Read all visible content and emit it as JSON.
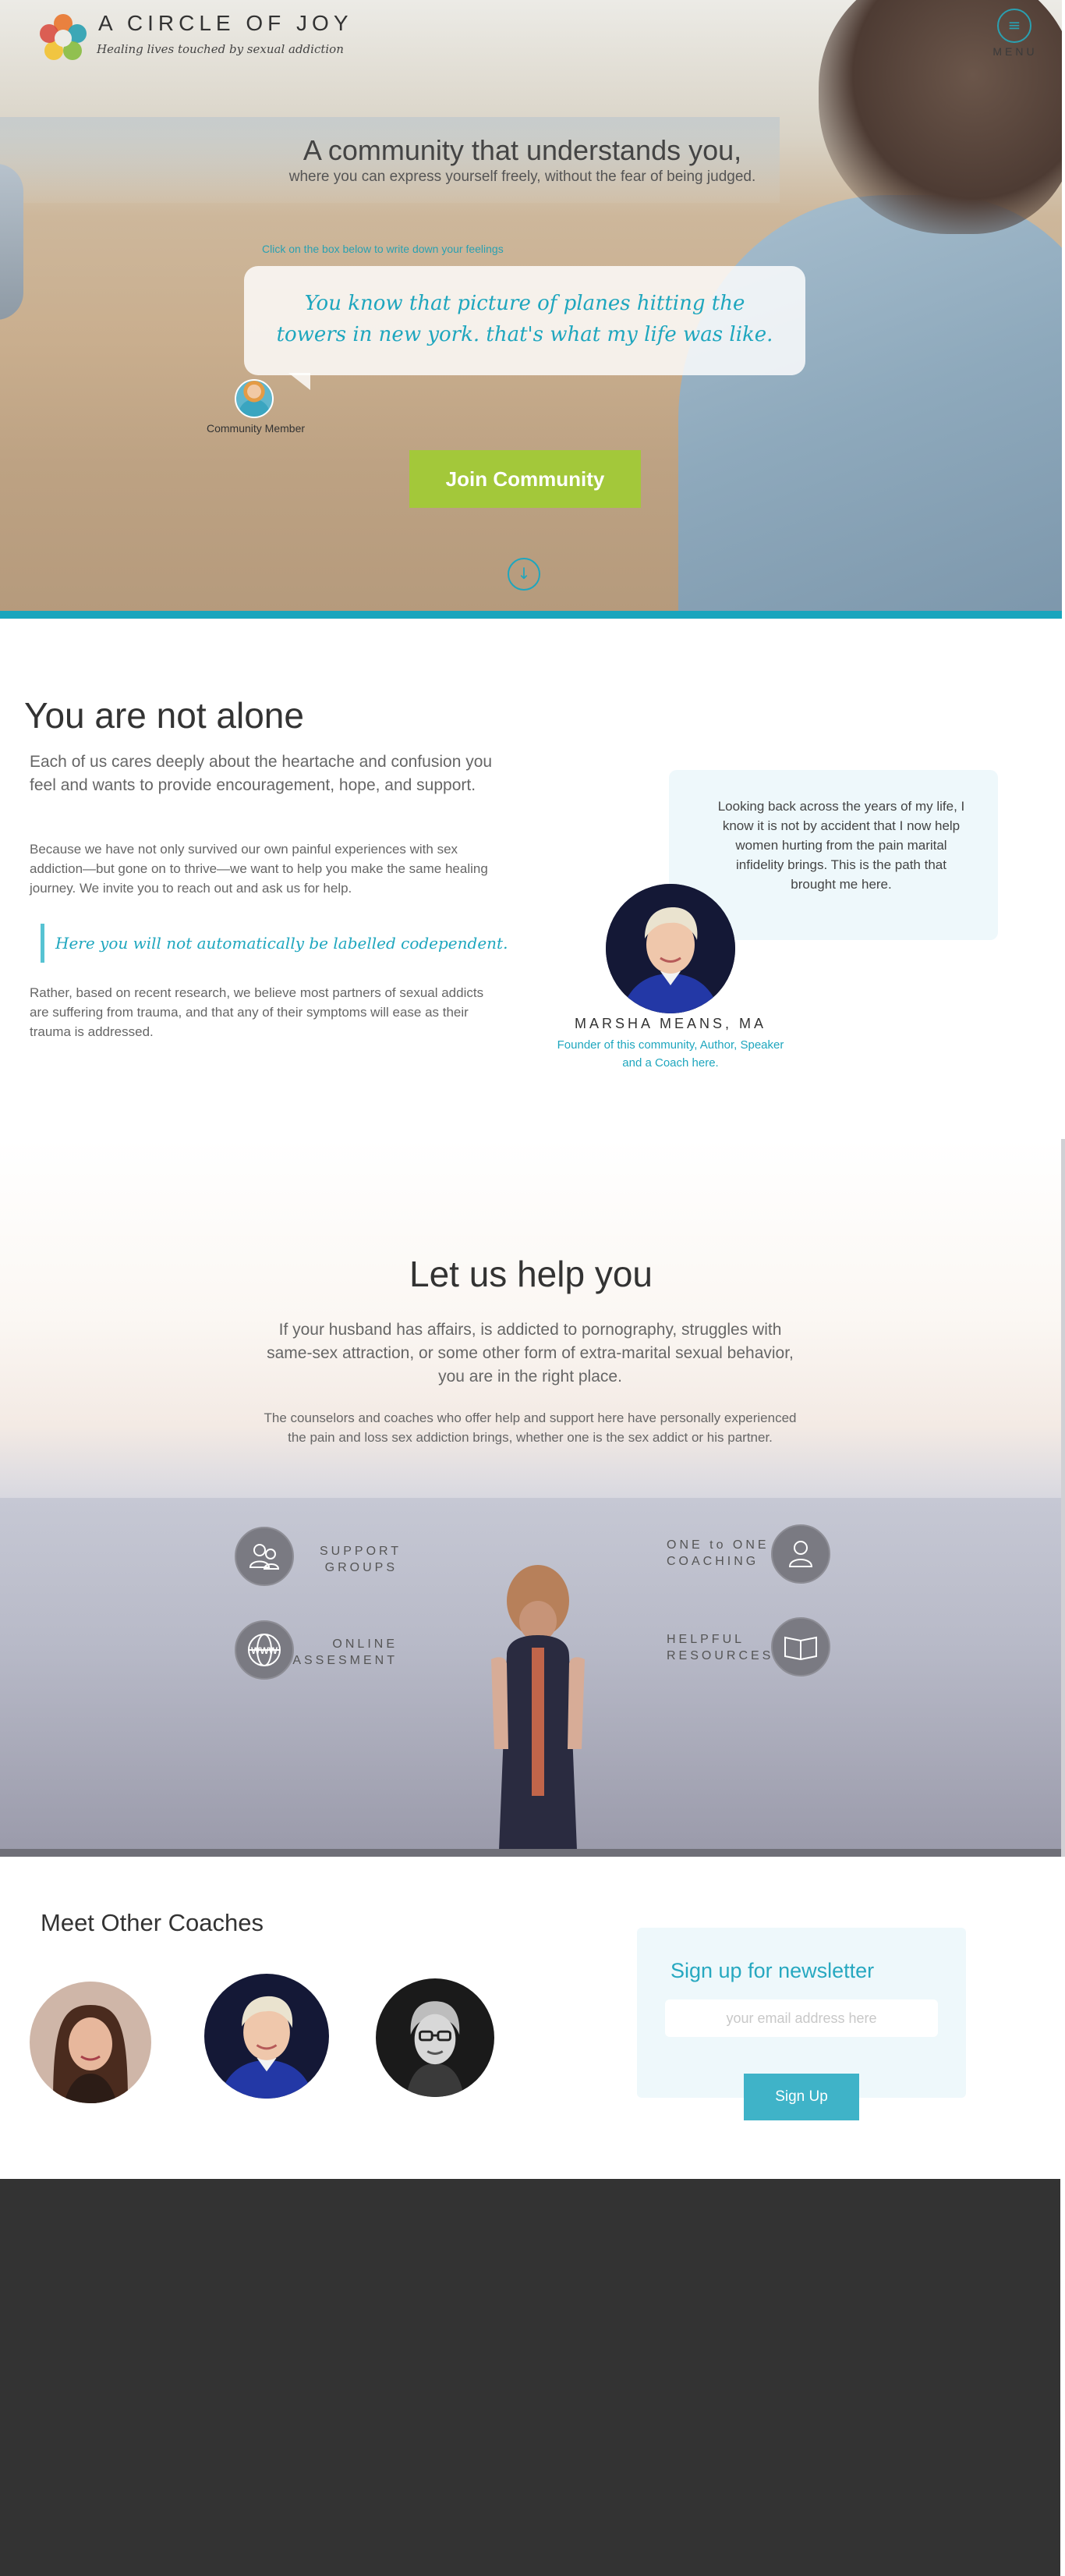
{
  "header": {
    "site_title": "A CIRCLE OF JOY",
    "tagline": "Healing lives touched by sexual addiction",
    "menu_label": "MENU"
  },
  "hero": {
    "headline": "A community that understands you,",
    "subheadline": "where you can express yourself freely, without the fear of being judged.",
    "feelings_hint": "Click on the box below to write down your feelings",
    "feelings_text": "You know that picture of planes hitting the towers in new york. that's what my life was like.",
    "member_label": "Community Member",
    "join_label": "Join Community",
    "scroll_icon": "arrow-down-circle-icon"
  },
  "not_alone": {
    "title": "You are not alone",
    "lead": "Each of us cares deeply about the heartache and confusion you feel and wants to provide encouragement, hope, and support.",
    "paragraph1": "Because we have not only survived our own painful experiences with sex addiction—but gone on to thrive—we want to help you make the same healing journey. We invite you to reach out and ask us for help.",
    "quote": "Here you will not automatically be labelled codependent.",
    "paragraph2": "Rather, based on recent research, we believe most partners of sexual addicts are suffering from trauma, and that any of their symptoms will ease as their trauma is addressed.",
    "testimonial": "Looking back across the years of my life, I know it is not by accident that I now help women hurting from the pain marital infidelity brings. This is the path that brought me here.",
    "founder_name": "MARSHA MEANS, MA",
    "founder_role": "Founder of this community, Author, Speaker and a Coach here."
  },
  "help": {
    "title": "Let us help you",
    "lead": "If your husband has affairs, is addicted to pornography, struggles with same-sex attraction, or some other form of extra-marital sexual behavior, you are in the right place.",
    "body": "The counselors and coaches who offer help and support here have personally experienced the pain and loss sex addiction brings, whether one is the sex addict or his partner.",
    "services": [
      {
        "line1": "SUPPORT",
        "line2": "GROUPS",
        "icon": "group-icon"
      },
      {
        "line1": "ONLINE",
        "line2": "ASSESMENT",
        "icon": "www-globe-icon"
      },
      {
        "line1": "ONE to ONE",
        "line2": "COACHING",
        "icon": "person-icon"
      },
      {
        "line1": "HELPFUL",
        "line2": "RESOURCES",
        "icon": "book-icon"
      }
    ]
  },
  "coaches": {
    "title": "Meet Other Coaches"
  },
  "newsletter": {
    "title": "Sign up for newsletter",
    "placeholder": "your email address here",
    "button": "Sign Up"
  },
  "colors": {
    "accent": "#1ea6be",
    "join_button": "#a3c83a",
    "signup_button": "#3fb3c8",
    "footer": "#333333"
  }
}
